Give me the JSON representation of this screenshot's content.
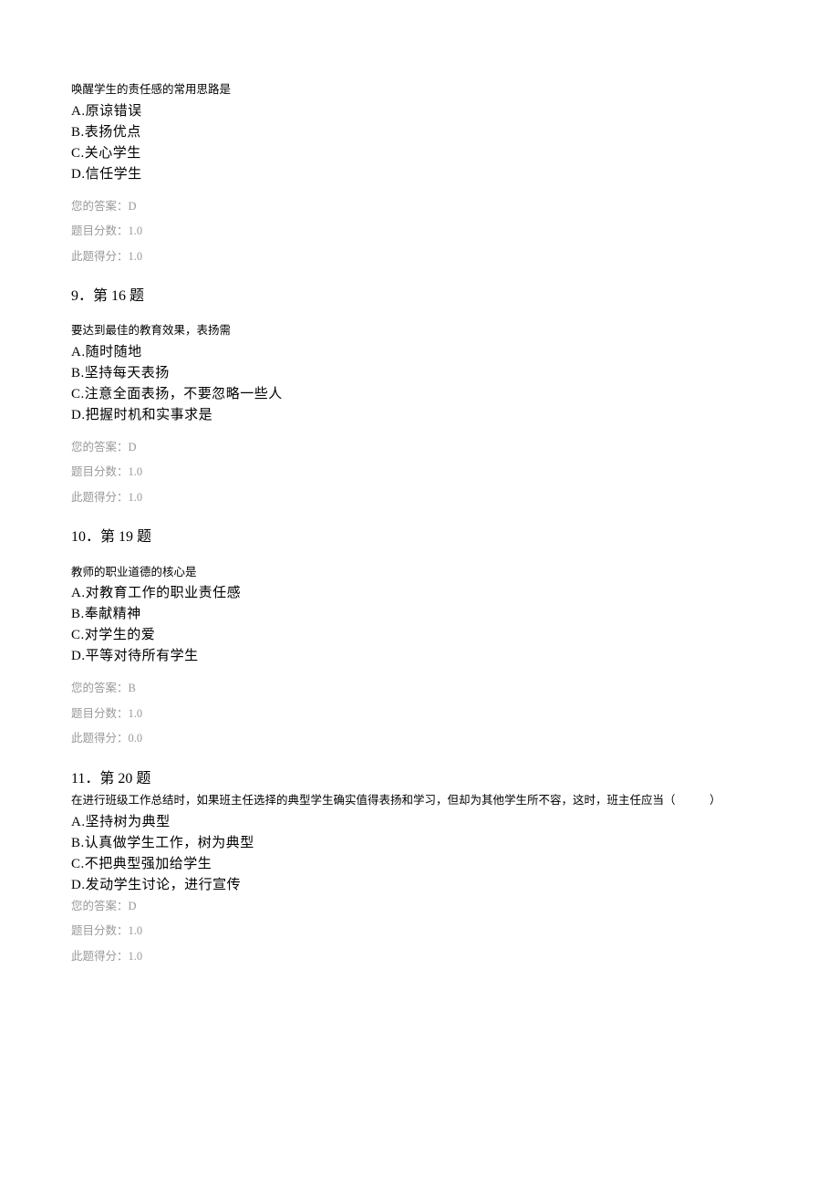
{
  "q8": {
    "stem": "唤醒学生的责任感的常用思路是",
    "options": {
      "A": "A.原谅错误",
      "B": "B.表扬优点",
      "C": "C.关心学生",
      "D": "D.信任学生"
    },
    "answerLabel": "您的答案：D",
    "totalLabel": "题目分数：1.0",
    "scoreLabel": "此题得分：1.0"
  },
  "q9": {
    "heading": "9．第 16 题",
    "stem": "要达到最佳的教育效果，表扬需",
    "options": {
      "A": "A.随时随地",
      "B": "B.坚持每天表扬",
      "C": "C.注意全面表扬，不要忽略一些人",
      "D": "D.把握时机和实事求是"
    },
    "answerLabel": "您的答案：D",
    "totalLabel": "题目分数：1.0",
    "scoreLabel": "此题得分：1.0"
  },
  "q10": {
    "heading": "10．第 19 题",
    "stem": "教师的职业道德的核心是",
    "options": {
      "A": "A.对教育工作的职业责任感",
      "B": "B.奉献精神",
      "C": "C.对学生的爱",
      "D": "D.平等对待所有学生"
    },
    "answerLabel": "您的答案：B",
    "totalLabel": "题目分数：1.0",
    "scoreLabel": "此题得分：0.0"
  },
  "q11": {
    "heading": "11．第 20 题",
    "stem": "在进行班级工作总结时，如果班主任选择的典型学生确实值得表扬和学习，但却为其他学生所不容，这时，班主任应当（　　　）",
    "options": {
      "A": "A.坚持树为典型",
      "B": "B.认真做学生工作，树为典型",
      "C": "C.不把典型强加给学生",
      "D": "D.发动学生讨论，进行宣传"
    },
    "answerLabel": "您的答案：D",
    "totalLabel": "题目分数：1.0",
    "scoreLabel": "此题得分：1.0"
  }
}
